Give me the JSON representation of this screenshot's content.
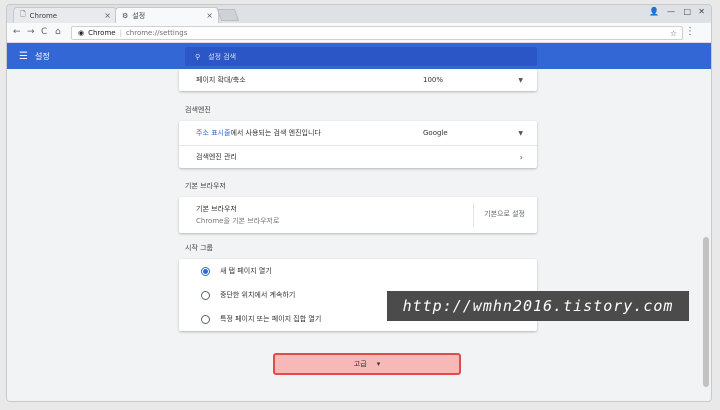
{
  "tabs": [
    {
      "title": "Chrome",
      "icon": "page-icon"
    },
    {
      "title": "설정",
      "icon": "gear-icon"
    }
  ],
  "address_bar": {
    "site": "Chrome",
    "url": "chrome://settings"
  },
  "header": {
    "title": "설정",
    "search_placeholder": "설정 검색"
  },
  "page_zoom": {
    "label": "페이지 확대/축소",
    "value": "100%"
  },
  "search_engine": {
    "section_title": "검색엔진",
    "link_text": "주소 표시줄",
    "row_text": "에서 사용되는 검색 엔진입니다",
    "value": "Google",
    "manage_label": "검색엔진 관리"
  },
  "default_browser": {
    "section_title": "기본 브라우저",
    "title": "기본 브라우저",
    "subtitle": "Chrome을 기본 브라우저로",
    "button": "기본으로 설정"
  },
  "startup": {
    "section_title": "시작 그룹",
    "options": [
      {
        "label": "새 탭 페이지 열기",
        "selected": true
      },
      {
        "label": "중단한 위치에서 계속하기",
        "selected": false
      },
      {
        "label": "특정 페이지 또는 페이지 집합 열기",
        "selected": false
      }
    ]
  },
  "advanced": {
    "label": "고급"
  },
  "watermark": "http://wmhn2016.tistory.com",
  "colors": {
    "header_blue": "#3367d6",
    "highlight_red": "#e34a4a"
  }
}
